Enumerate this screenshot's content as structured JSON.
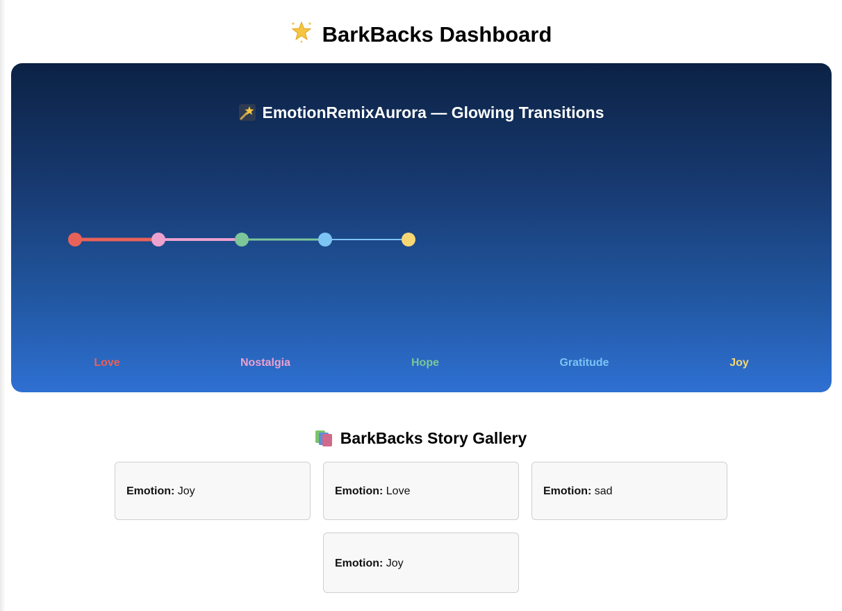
{
  "header": {
    "title": "BarkBacks Dashboard",
    "icon": "star-sparkle-icon"
  },
  "aurora": {
    "title": "EmotionRemixAurora — Glowing Transitions",
    "icon": "shooting-star-icon",
    "emotions": [
      {
        "label": "Love",
        "color": "#e8625a"
      },
      {
        "label": "Nostalgia",
        "color": "#eda1cf"
      },
      {
        "label": "Hope",
        "color": "#7cc69a"
      },
      {
        "label": "Gratitude",
        "color": "#7cc4f4"
      },
      {
        "label": "Joy",
        "color": "#f7d774"
      }
    ],
    "timeline_nodes": [
      {
        "emotion": "Love",
        "color": "#e8625a"
      },
      {
        "emotion": "Nostalgia",
        "color": "#eda1cf"
      },
      {
        "emotion": "Hope",
        "color": "#7cc69a"
      },
      {
        "emotion": "Gratitude",
        "color": "#7cc4f4"
      },
      {
        "emotion": "Joy",
        "color": "#f7d774"
      }
    ]
  },
  "gallery": {
    "title": "BarkBacks Story Gallery",
    "icon": "books-icon",
    "field_label": "Emotion:",
    "cards": [
      {
        "emotion": "Joy"
      },
      {
        "emotion": "Love"
      },
      {
        "emotion": "sad"
      },
      {
        "emotion": "Joy"
      }
    ]
  }
}
